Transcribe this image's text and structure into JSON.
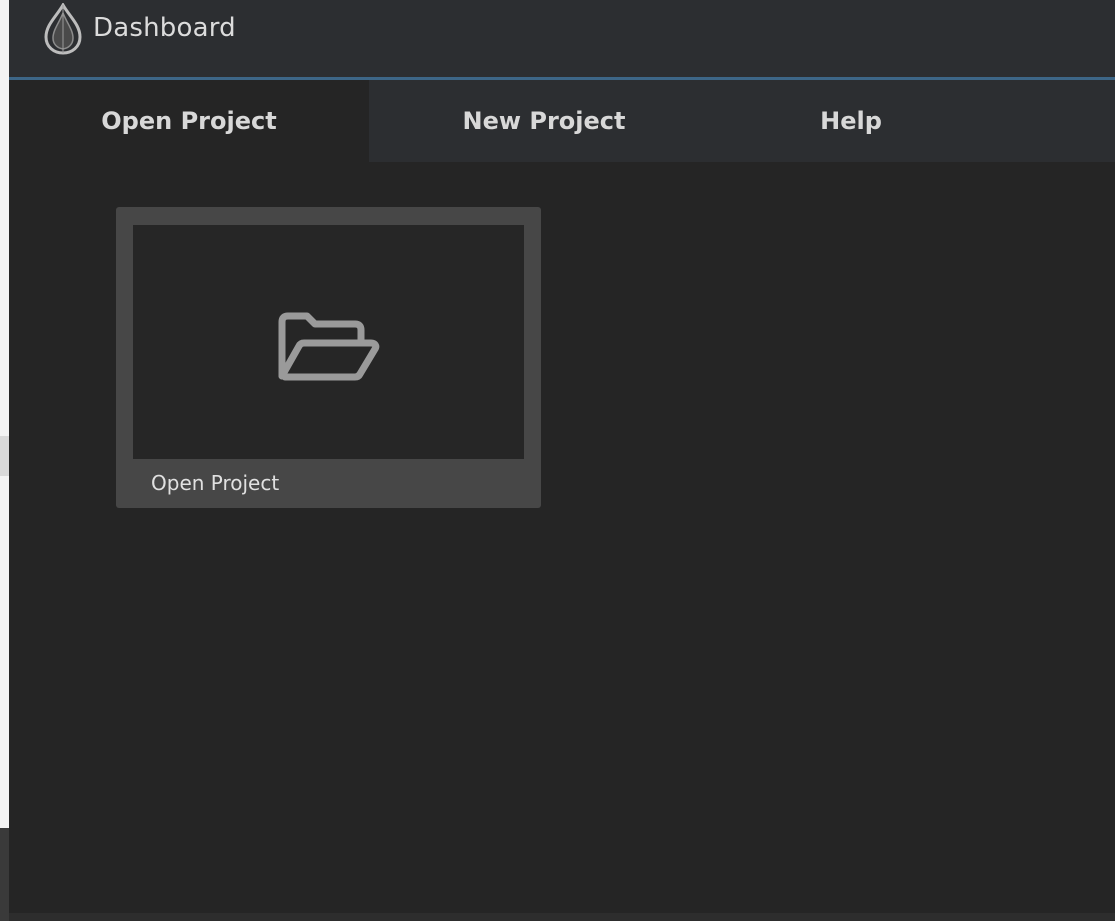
{
  "window": {
    "title": "Dashboard",
    "logo_icon": "drop-logo-icon"
  },
  "tabs": [
    {
      "label": "Open Project",
      "active": true
    },
    {
      "label": "New Project",
      "active": false
    },
    {
      "label": "Help",
      "active": false
    }
  ],
  "content": {
    "cards": [
      {
        "label": "Open Project",
        "icon": "folder-open-icon"
      }
    ]
  },
  "colors": {
    "accent": "#3d6687",
    "titlebar": "#2c2e31",
    "background": "#252525",
    "card": "#474747",
    "icon": "#9a9a9a"
  }
}
